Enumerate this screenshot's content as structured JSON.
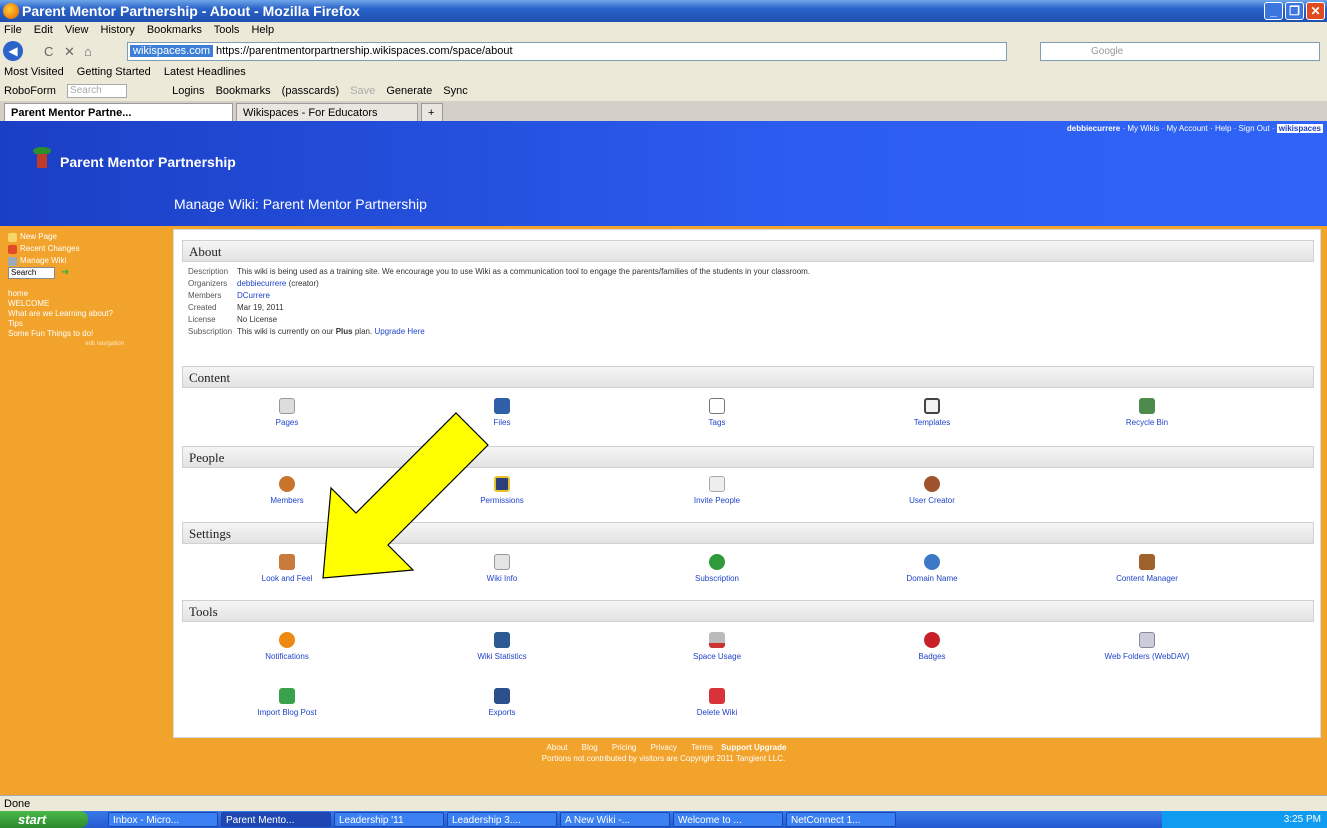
{
  "window": {
    "title": "Parent Mentor Partnership - About - Mozilla Firefox"
  },
  "menubar": [
    "File",
    "Edit",
    "View",
    "History",
    "Bookmarks",
    "Tools",
    "Help"
  ],
  "navbar": {
    "site_badge": "wikispaces.com",
    "url": "https://parentmentorpartnership.wikispaces.com/space/about",
    "search_placeholder": "Google"
  },
  "bookmarks": [
    "Most Visited",
    "Getting Started",
    "Latest Headlines"
  ],
  "roboform": {
    "label": "RoboForm",
    "search": "Search",
    "logins": "Logins",
    "bookmarks": "Bookmarks",
    "passcards": "(passcards)",
    "save": "Save",
    "generate": "Generate",
    "sync": "Sync"
  },
  "tabs": [
    "Parent Mentor Partne...",
    "Wikispaces - For Educators"
  ],
  "header": {
    "site_name": "Parent Mentor Partnership",
    "manage_title": "Manage Wiki: Parent Mentor Partnership",
    "user": "debbiecurrere",
    "links": [
      "My Wikis",
      "My Account",
      "Help",
      "Sign Out"
    ],
    "badge": "wikispaces"
  },
  "sidebar": {
    "actions": [
      "New Page",
      "Recent Changes",
      "Manage Wiki"
    ],
    "search_value": "Search",
    "nav": [
      "home",
      "WELCOME",
      "What are we Learning about?",
      "Tips",
      "Some Fun Things to do!"
    ],
    "edit_navigation": "edit navigation"
  },
  "about": {
    "heading": "About",
    "rows": [
      {
        "k": "Description",
        "v": "This wiki is being used as a training site. We encourage you to use Wiki as a communication tool to engage the parents/families of the students in your classroom."
      },
      {
        "k": "Organizers",
        "v": "debbiecurrere",
        "suffix": "(creator)"
      },
      {
        "k": "Members",
        "v": "DCurrere"
      },
      {
        "k": "Created",
        "v": "Mar 19, 2011"
      },
      {
        "k": "License",
        "v": "No License"
      },
      {
        "k": "Subscription",
        "v": "This wiki is currently on our",
        "plan": "Plus",
        "after": "plan.",
        "link": "Upgrade Here"
      }
    ]
  },
  "sections": {
    "content": {
      "heading": "Content",
      "items": [
        "Pages",
        "Files",
        "Tags",
        "Templates",
        "Recycle Bin"
      ]
    },
    "people": {
      "heading": "People",
      "items": [
        "Members",
        "Permissions",
        "Invite People",
        "User Creator"
      ]
    },
    "settings": {
      "heading": "Settings",
      "items": [
        "Look and Feel",
        "Wiki Info",
        "Subscription",
        "Domain Name",
        "Content Manager"
      ]
    },
    "tools": {
      "heading": "Tools",
      "items": [
        "Notifications",
        "Wiki Statistics",
        "Space Usage",
        "Badges",
        "Web Folders (WebDAV)",
        "Import Blog Post",
        "Exports",
        "Delete Wiki"
      ]
    }
  },
  "footer": {
    "links": [
      "About",
      "Blog",
      "Pricing",
      "Privacy",
      "Terms",
      "Support",
      "Upgrade"
    ],
    "copyright": "Portions not contributed by visitors are Copyright 2011 Tangient LLC."
  },
  "status": "Done",
  "taskbar": {
    "start": "start",
    "buttons": [
      "Inbox - Micro...",
      "Parent Mento...",
      "Leadership '11",
      "Leadership 3....",
      "A New Wiki -...",
      "Welcome to ...",
      "NetConnect 1..."
    ],
    "time": "3:25 PM"
  },
  "colors": {
    "page_bg": "#f1a32b",
    "header": "#2c5cf0",
    "link": "#1f44c9",
    "arrow": "#ffff00"
  }
}
